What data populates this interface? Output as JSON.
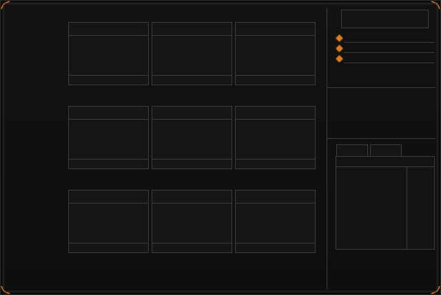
{
  "colors": {
    "background": "#0b0c0b",
    "border": "#3b3e3b",
    "accent": "#e07a1c"
  },
  "icons": {
    "corner": "ornament-corner-icon",
    "bullet": "diamond-bullet-icon"
  }
}
